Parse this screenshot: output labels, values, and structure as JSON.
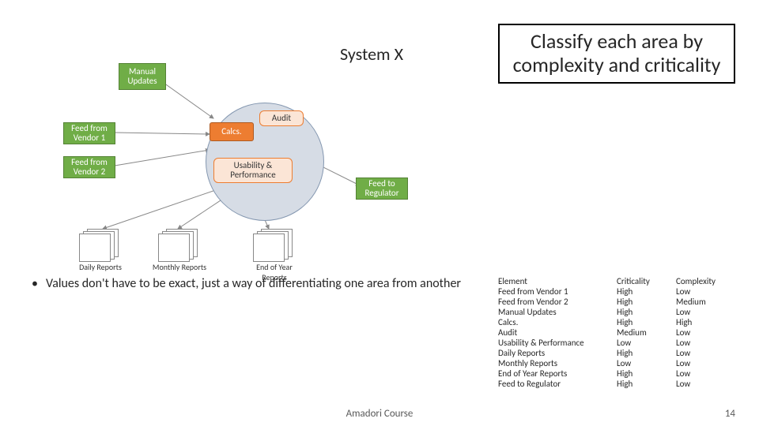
{
  "system_title": "System X",
  "headline": "Classify each area by complexity and criticality",
  "nodes": {
    "manual_updates": "Manual Updates",
    "feed_v1": "Feed from Vendor 1",
    "feed_v2": "Feed from Vendor 2",
    "calcs": "Calcs.",
    "audit": "Audit",
    "usability": "Usability & Performance",
    "feed_reg": "Feed to Regulator",
    "daily": "Daily Reports",
    "monthly": "Monthly Reports",
    "eoy": "End of Year Reports"
  },
  "bullet": "Values don't have to be exact, just a way of differentiating one area from another",
  "table": {
    "headers": {
      "c1": "Element",
      "c2": "Criticality",
      "c3": "Complexity"
    },
    "rows": [
      {
        "c1": "Feed from Vendor 1",
        "c2": "High",
        "c3": "Low"
      },
      {
        "c1": "Feed from Vendor 2",
        "c2": "High",
        "c3": "Medium"
      },
      {
        "c1": "Manual Updates",
        "c2": "High",
        "c3": "Low"
      },
      {
        "c1": "Calcs.",
        "c2": "High",
        "c3": "High"
      },
      {
        "c1": "Audit",
        "c2": "Medium",
        "c3": "Low"
      },
      {
        "c1": "Usability & Performance",
        "c2": "Low",
        "c3": "Low"
      },
      {
        "c1": "Daily Reports",
        "c2": "High",
        "c3": "Low"
      },
      {
        "c1": "Monthly Reports",
        "c2": "Low",
        "c3": "Low"
      },
      {
        "c1": "End of Year Reports",
        "c2": "High",
        "c3": "Low"
      },
      {
        "c1": "Feed to Regulator",
        "c2": "High",
        "c3": "Low"
      }
    ]
  },
  "footer": "Amadori Course",
  "page_num": "14"
}
